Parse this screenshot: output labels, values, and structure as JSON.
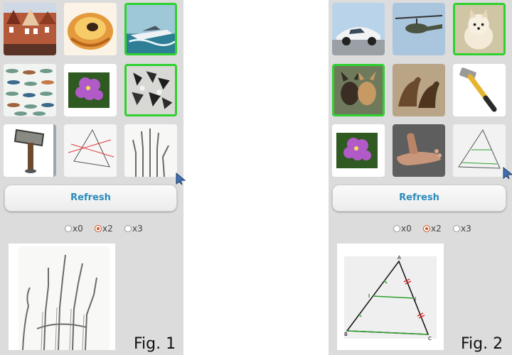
{
  "left_panel": {
    "tiles": [
      {
        "icon": "street-houses-image",
        "selected": false
      },
      {
        "icon": "pastry-image",
        "selected": false
      },
      {
        "icon": "speedboat-image",
        "selected": true
      },
      {
        "icon": "fish-pattern-image",
        "selected": false
      },
      {
        "icon": "flower-image",
        "selected": false
      },
      {
        "icon": "animals-collage-image",
        "selected": true
      },
      {
        "icon": "signpost-image",
        "selected": false
      },
      {
        "icon": "triangle-diagram-image",
        "selected": false
      },
      {
        "icon": "hand-xray-image",
        "selected": false
      }
    ],
    "refresh_label": "Refresh",
    "radio_options": [
      {
        "label": "x0",
        "checked": false
      },
      {
        "label": "x2",
        "checked": true
      },
      {
        "label": "x3",
        "checked": false
      }
    ],
    "preview_icon": "hand-xray-image",
    "caption": "Fig. 1"
  },
  "right_panel": {
    "tiles": [
      {
        "icon": "sports-car-image",
        "selected": false
      },
      {
        "icon": "helicopter-image",
        "selected": false
      },
      {
        "icon": "small-dog-image",
        "selected": true
      },
      {
        "icon": "chihuahuas-image",
        "selected": true
      },
      {
        "icon": "horses-image",
        "selected": false
      },
      {
        "icon": "hammer-image",
        "selected": false
      },
      {
        "icon": "flower-image",
        "selected": false
      },
      {
        "icon": "feet-image",
        "selected": false
      },
      {
        "icon": "triangle-diagram-image",
        "selected": false
      }
    ],
    "refresh_label": "Refresh",
    "radio_options": [
      {
        "label": "x0",
        "checked": false
      },
      {
        "label": "x2",
        "checked": true
      },
      {
        "label": "x3",
        "checked": false
      }
    ],
    "preview_icon": "triangle-diagram-image",
    "preview_labels": {
      "a": "A",
      "b": "B",
      "c": "C",
      "i": "I",
      "j": "J"
    },
    "caption": "Fig. 2"
  },
  "colors": {
    "panel_bg": "#dcdcdc",
    "selected_border": "#2fd12f",
    "refresh_text": "#2b8bbb",
    "radio_checked": "#d0531f"
  }
}
